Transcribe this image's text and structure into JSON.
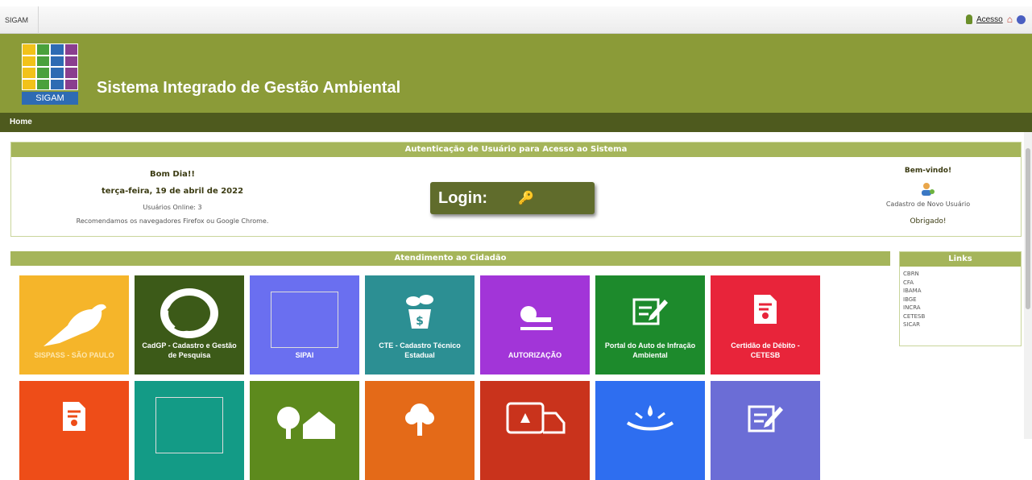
{
  "topbar": {
    "tab_label": "SIGAM",
    "tools": {
      "access_link": "Acesso"
    }
  },
  "header": {
    "logo_text": "SIGAM",
    "title": "Sistema Integrado de Gestão Ambiental"
  },
  "nav": {
    "home": "Home"
  },
  "auth": {
    "heading": "Autenticação de Usuário para Acesso ao Sistema",
    "greeting": "Bom Dia!!",
    "date": "terça-feira, 19 de abril de 2022",
    "users_online": "Usuários Online: 3",
    "recommend": "Recomendamos os navegadores Firefox ou Google Chrome.",
    "login_label": "Login:",
    "welcome": "Bem-vindo!",
    "new_user": "Cadastro de Novo Usuário",
    "thanks": "Obrigado!"
  },
  "citizen": {
    "heading": "Atendimento ao Cidadão",
    "tiles": [
      {
        "label": "SISPASS - SÃO PAULO",
        "color": "#f5b52a",
        "icon": "bird-icon"
      },
      {
        "label": "CadGP - Cadastro e Gestão de Pesquisa",
        "color": "#3c5a18",
        "icon": "leaf-wreath-icon"
      },
      {
        "label": "SIPAI",
        "color": "#6a6ff0",
        "icon": "broken-image-icon"
      },
      {
        "label": "CTE - Cadastro Técnico Estadual",
        "color": "#2c8f93",
        "icon": "plant-money-icon"
      },
      {
        "label": "AUTORIZAÇÃO",
        "color": "#a235d8",
        "icon": "stamp-icon"
      },
      {
        "label": "Portal do Auto de Infração Ambiental",
        "color": "#1d8a2c",
        "icon": "edit-form-icon"
      },
      {
        "label": "Certidão de Débito - CETESB",
        "color": "#e8243a",
        "icon": "certificate-icon"
      },
      {
        "label": "",
        "color": "#ee4d18",
        "icon": "certificate-icon"
      },
      {
        "label": "",
        "color": "#139b86",
        "icon": "broken-image-icon"
      },
      {
        "label": "",
        "color": "#5d8a1d",
        "icon": "tree-house-icon"
      },
      {
        "label": "",
        "color": "#e46a18",
        "icon": "tree-hand-icon"
      },
      {
        "label": "",
        "color": "#c9331c",
        "icon": "recycle-truck-icon"
      },
      {
        "label": "",
        "color": "#2e6ef0",
        "icon": "water-hands-icon"
      },
      {
        "label": "",
        "color": "#6b6dd6",
        "icon": "edit-form-icon"
      }
    ]
  },
  "links": {
    "heading": "Links",
    "items": [
      "CBRN",
      "CFA",
      "IBAMA",
      "IBGE",
      "INCRA",
      "CETESB",
      "SICAR"
    ]
  }
}
